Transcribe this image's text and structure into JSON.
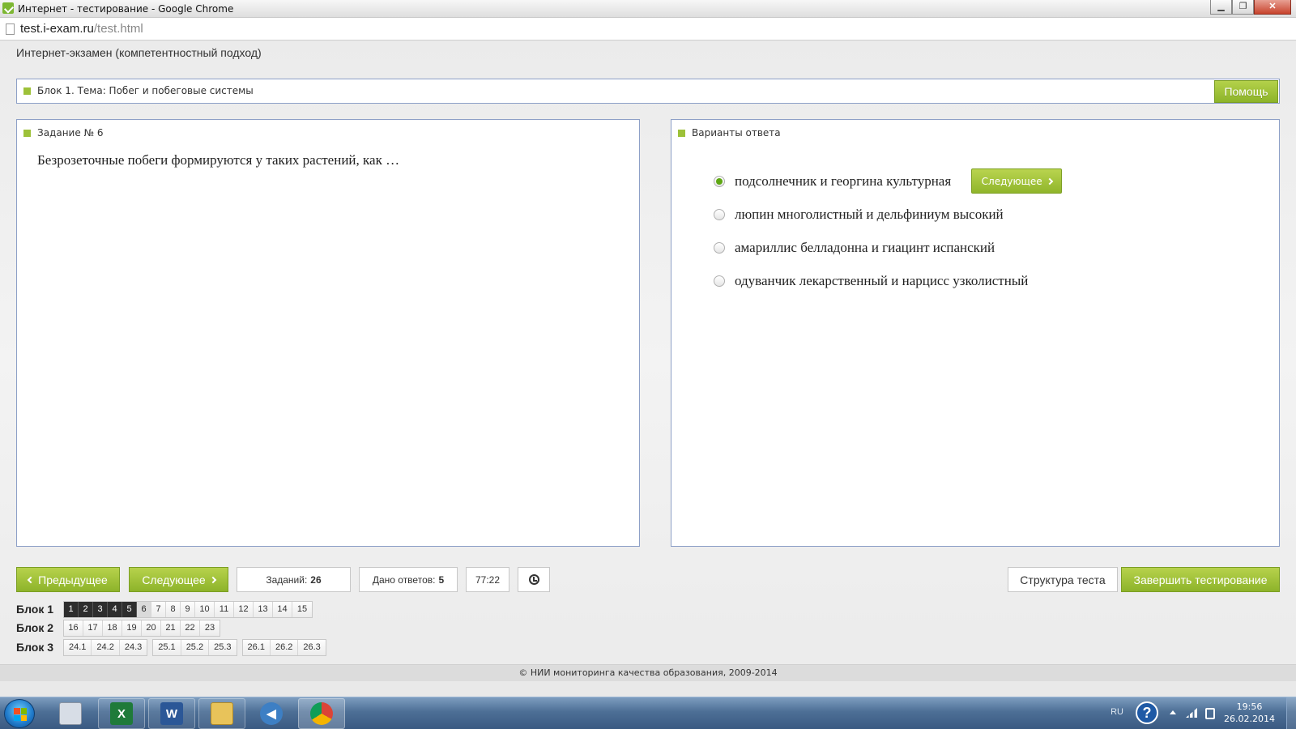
{
  "window": {
    "title": "Интернет - тестирование - Google Chrome",
    "minimize_glyph": "▁",
    "maximize_glyph": "❐",
    "close_glyph": "✕"
  },
  "address": {
    "host": "test.i-exam.ru",
    "path": "/test.html"
  },
  "page": {
    "title": "Интернет-экзамен (компетентностный подход)"
  },
  "block_bar": {
    "label": "Блок 1. Тема: Побег и побеговые системы",
    "help_label": "Помощь"
  },
  "task": {
    "header": "Задание № 6",
    "question": "Безрозеточные побеги формируются у таких растений, как …"
  },
  "answers": {
    "header": "Варианты ответа",
    "next_label": "Следующее",
    "options": [
      {
        "text": "подсолнечник и георгина культурная",
        "selected": true
      },
      {
        "text": "люпин многолистный и дельфиниум высокий",
        "selected": false
      },
      {
        "text": "амариллис белладонна и гиацинт испанский",
        "selected": false
      },
      {
        "text": "одуванчик лекарственный и нарцисс узколистный",
        "selected": false
      }
    ]
  },
  "controls": {
    "prev_label": "Предыдущее",
    "next_label": "Следующее",
    "tasks_label": "Заданий:",
    "tasks_count": "26",
    "answered_label": "Дано ответов:",
    "answered_count": "5",
    "timer": "77:22",
    "structure_label": "Структура теста",
    "finish_label": "Завершить тестирование"
  },
  "navigator": {
    "block1": {
      "label": "Блок 1",
      "items": [
        "1",
        "2",
        "3",
        "4",
        "5",
        "6",
        "7",
        "8",
        "9",
        "10",
        "11",
        "12",
        "13",
        "14",
        "15"
      ]
    },
    "block2": {
      "label": "Блок 2",
      "items": [
        "16",
        "17",
        "18",
        "19",
        "20",
        "21",
        "22",
        "23"
      ]
    },
    "block3": {
      "label": "Блок 3",
      "groups": [
        [
          "24.1",
          "24.2",
          "24.3"
        ],
        [
          "25.1",
          "25.2",
          "25.3"
        ],
        [
          "26.1",
          "26.2",
          "26.3"
        ]
      ]
    }
  },
  "footer": {
    "text": "© НИИ мониторинга качества образования, 2009-2014"
  },
  "taskbar": {
    "lang": "RU",
    "time": "19:56",
    "date": "26.02.2014",
    "help_glyph": "?",
    "excel_glyph": "X",
    "word_glyph": "W",
    "media_glyph": "◀"
  },
  "colors": {
    "accent_green": "#9dc139",
    "panel_border": "#8da0c7",
    "answered_dark": "#2d2d2d"
  }
}
